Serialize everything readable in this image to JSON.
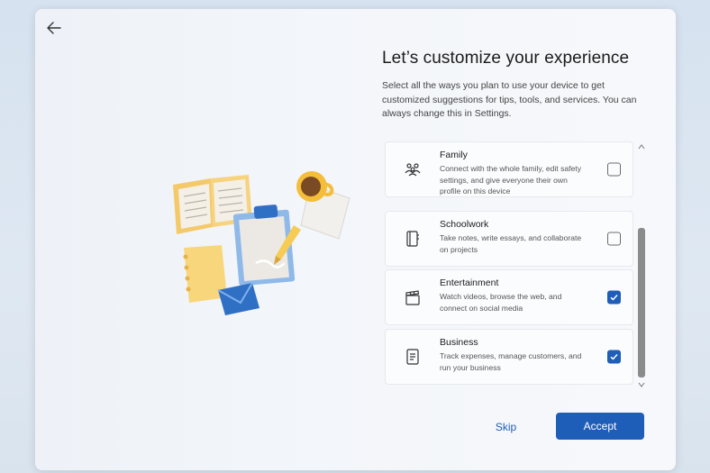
{
  "dialog": {
    "title": "Let’s customize your experience",
    "description": "Select all the ways you plan to use your device to get customized suggestions for tips, tools, and services. You can always change this in Settings."
  },
  "options": [
    {
      "title": "Family",
      "description": "Connect with the whole family, edit safety settings, and give everyone their own profile on this device",
      "checked": false,
      "icon": "family-icon"
    },
    {
      "title": "Schoolwork",
      "description": "Take notes, write essays, and collaborate on projects",
      "checked": false,
      "icon": "notebook-icon"
    },
    {
      "title": "Entertainment",
      "description": "Watch videos, browse the web, and connect on social media",
      "checked": true,
      "icon": "clapperboard-icon"
    },
    {
      "title": "Business",
      "description": "Track expenses, manage customers, and run your business",
      "checked": true,
      "icon": "document-icon"
    }
  ],
  "buttons": {
    "skip": "Skip",
    "accept": "Accept"
  },
  "colors": {
    "accent": "#1f5eb8",
    "checkbox_border": "#6b6b6b"
  }
}
